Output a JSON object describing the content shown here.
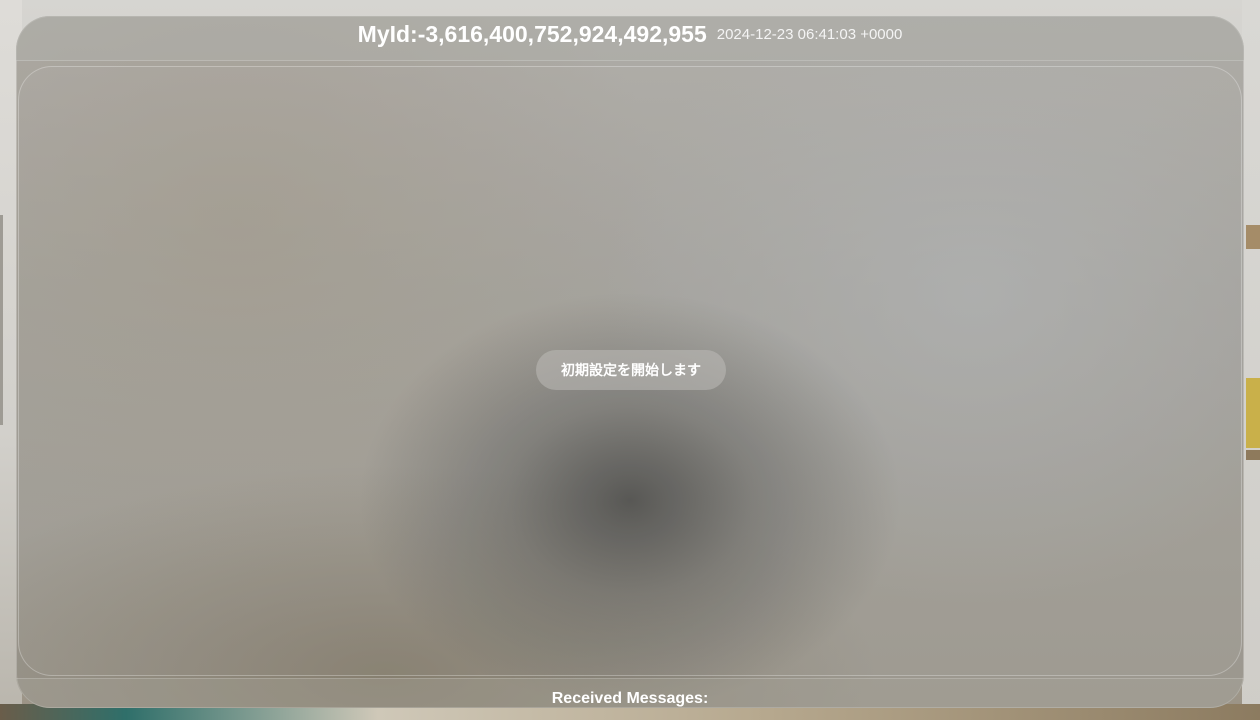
{
  "header": {
    "my_id": "MyId:-3,616,400,752,924,492,955",
    "timestamp": "2024-12-23 06:41:03 +0000"
  },
  "main": {
    "status_text": "初期設定を開始します"
  },
  "footer": {
    "received_messages_label": "Received Messages:"
  }
}
